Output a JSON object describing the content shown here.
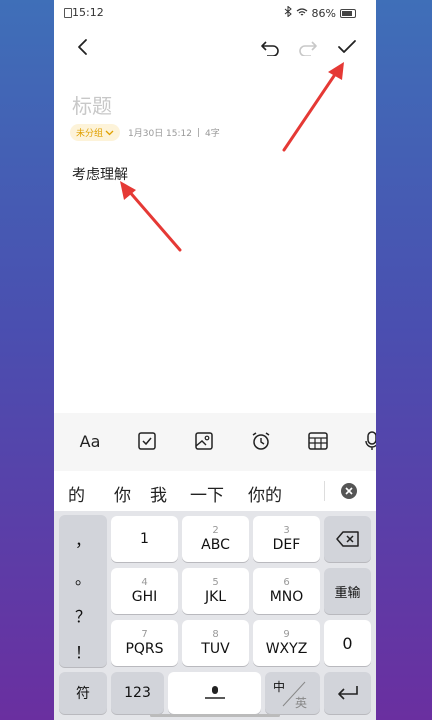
{
  "status": {
    "time": "15:12",
    "battery": "86%"
  },
  "editor": {
    "title_placeholder": "标题",
    "folder": "未分组",
    "date": "1月30日 15:12",
    "separator": "|",
    "char_count": "4字",
    "content": "考虑理解"
  },
  "format_toolbar": {
    "text_style_label": "Aa"
  },
  "candidates": [
    "的",
    "你",
    "我",
    "一下",
    "你的"
  ],
  "keyboard": {
    "punctuation": [
      "，",
      "。",
      "？",
      "！"
    ],
    "keys": [
      {
        "sub": "",
        "main": "1"
      },
      {
        "sub": "2",
        "main": "ABC"
      },
      {
        "sub": "3",
        "main": "DEF"
      },
      {
        "sub": "4",
        "main": "GHI"
      },
      {
        "sub": "5",
        "main": "JKL"
      },
      {
        "sub": "6",
        "main": "MNO"
      },
      {
        "sub": "7",
        "main": "PQRS"
      },
      {
        "sub": "8",
        "main": "TUV"
      },
      {
        "sub": "9",
        "main": "WXYZ"
      }
    ],
    "retype": "重输",
    "zero": "0",
    "symbols": "符",
    "numbers": "123",
    "lang_zh": "中",
    "lang_en": "英"
  }
}
